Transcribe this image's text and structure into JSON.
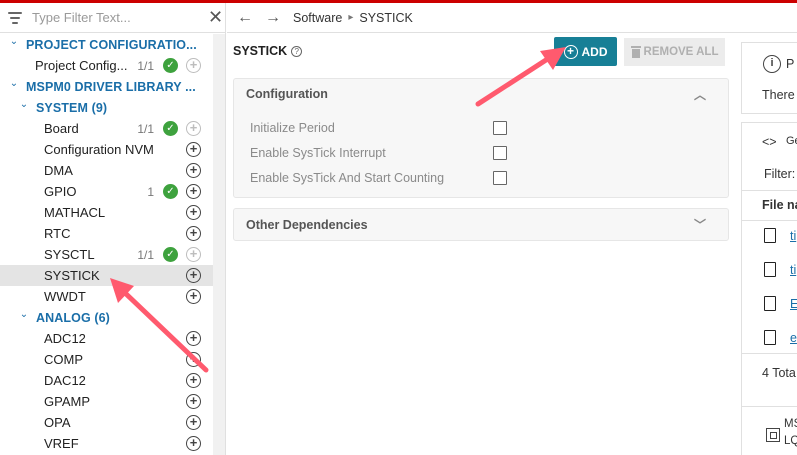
{
  "filter": {
    "placeholder": "Type Filter Text..."
  },
  "breadcrumb": {
    "section": "Software",
    "current": "SYSTICK"
  },
  "tree": [
    {
      "kind": "cat",
      "label": "PROJECT CONFIGURATIO..."
    },
    {
      "kind": "item",
      "label": "Project Config...",
      "count": "1/1",
      "check": true,
      "plus": "dim",
      "indent": 1
    },
    {
      "kind": "cat",
      "label": "MSPM0 DRIVER LIBRARY ..."
    },
    {
      "kind": "cat",
      "label": "SYSTEM (9)",
      "indent": 1
    },
    {
      "kind": "item",
      "label": "Board",
      "count": "1/1",
      "check": true,
      "plus": "dim"
    },
    {
      "kind": "item",
      "label": "Configuration NVM",
      "plus": "on"
    },
    {
      "kind": "item",
      "label": "DMA",
      "plus": "on"
    },
    {
      "kind": "item",
      "label": "GPIO",
      "count": "1",
      "check": true,
      "plus": "on"
    },
    {
      "kind": "item",
      "label": "MATHACL",
      "plus": "on"
    },
    {
      "kind": "item",
      "label": "RTC",
      "plus": "on"
    },
    {
      "kind": "item",
      "label": "SYSCTL",
      "count": "1/1",
      "check": true,
      "plus": "dim"
    },
    {
      "kind": "item",
      "label": "SYSTICK",
      "plus": "on",
      "selected": true
    },
    {
      "kind": "item",
      "label": "WWDT",
      "plus": "on"
    },
    {
      "kind": "cat",
      "label": "ANALOG (6)",
      "indent": 1
    },
    {
      "kind": "item",
      "label": "ADC12",
      "plus": "on"
    },
    {
      "kind": "item",
      "label": "COMP",
      "plus": "on"
    },
    {
      "kind": "item",
      "label": "DAC12",
      "plus": "on"
    },
    {
      "kind": "item",
      "label": "GPAMP",
      "plus": "on"
    },
    {
      "kind": "item",
      "label": "OPA",
      "plus": "on"
    },
    {
      "kind": "item",
      "label": "VREF",
      "plus": "on"
    }
  ],
  "main": {
    "title": "SYSTICK",
    "add_label": "ADD",
    "remove_label": "REMOVE ALL",
    "configuration": {
      "heading": "Configuration",
      "fields": [
        "Initialize Period",
        "Enable SysTick Interrupt",
        "Enable SysTick And Start Counting"
      ]
    },
    "other_dependencies": "Other Dependencies"
  },
  "right": {
    "info_text": "There",
    "generated_label": "Ge",
    "filter_label": "Filter:",
    "file_name_label": "File na",
    "files": [
      "ti",
      "ti",
      "E",
      "e"
    ],
    "total": "4 Tota",
    "device_line1": "MS",
    "device_line2": "LQ"
  },
  "colors": {
    "accent": "#177f96",
    "category": "#1a6ea8",
    "check": "#3ea23e",
    "arrow": "#ff5a6e"
  }
}
